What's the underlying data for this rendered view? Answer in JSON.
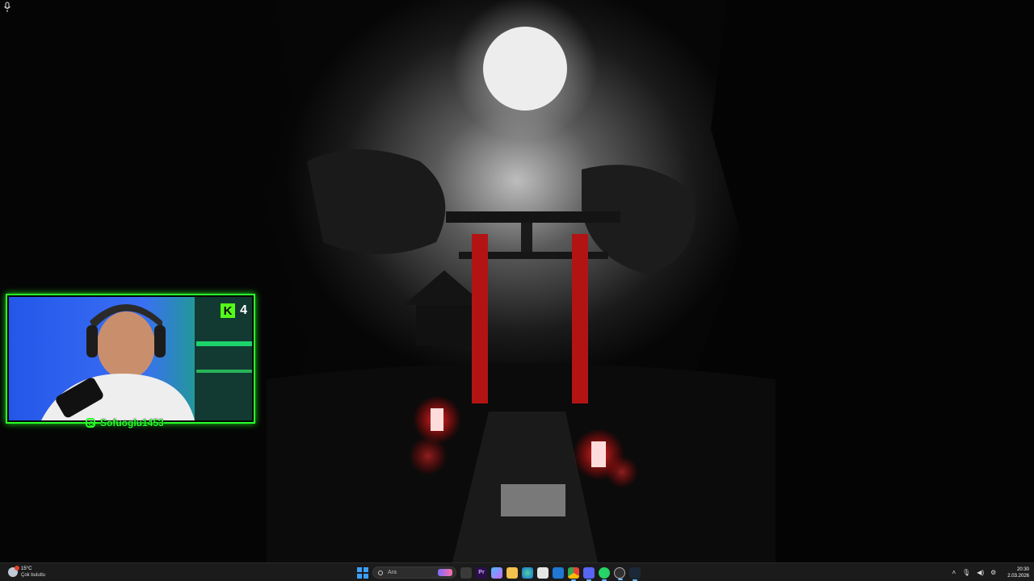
{
  "webcam": {
    "platform_badge": "K",
    "viewer_count": "4",
    "instagram_handle": "Sofuoglu1453"
  },
  "taskbar": {
    "weather": {
      "temperature": "15°C",
      "condition": "Çok bulutlu"
    },
    "search_placeholder": "Ara",
    "apps": [
      {
        "name": "task-view",
        "label": ""
      },
      {
        "name": "premiere",
        "label": "Pr"
      },
      {
        "name": "copilot",
        "label": ""
      },
      {
        "name": "file-explorer",
        "label": ""
      },
      {
        "name": "edge",
        "label": ""
      },
      {
        "name": "store",
        "label": ""
      },
      {
        "name": "mail",
        "label": ""
      },
      {
        "name": "chrome",
        "label": ""
      },
      {
        "name": "discord",
        "label": ""
      },
      {
        "name": "whatsapp",
        "label": ""
      },
      {
        "name": "obs",
        "label": ""
      },
      {
        "name": "steam",
        "label": ""
      }
    ],
    "clock": {
      "time": "20:30",
      "date": "2.03.2026"
    }
  },
  "colors": {
    "overlay_accent": "#2bff2b",
    "kick_green": "#53fc18",
    "taskbar_bg": "#1b1b1b"
  }
}
